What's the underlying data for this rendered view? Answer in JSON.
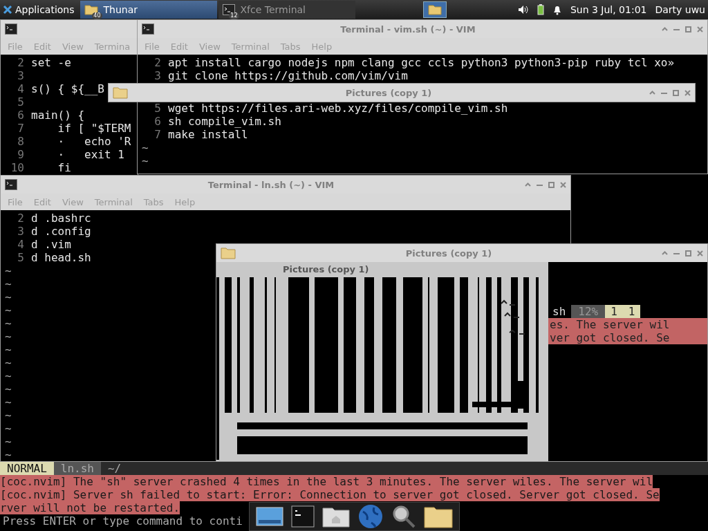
{
  "panel": {
    "apps_menu": "Applications",
    "tasks": [
      {
        "label": "Thunar",
        "badge": "40",
        "selected": true,
        "kind": "folder"
      },
      {
        "label": "Xfce Terminal",
        "badge": "12",
        "selected": false,
        "kind": "terminal"
      }
    ],
    "clock": "Sun  3 Jul, 01:01",
    "user": "Darty uwu"
  },
  "windows": [
    {
      "kind": "terminal",
      "menu": [
        "File",
        "Edit",
        "View",
        "Termina"
      ],
      "lines": [
        {
          "num": "2",
          "text": "set -e"
        },
        {
          "num": "3"
        },
        {
          "num": "4",
          "text": "s() { ${__B"
        },
        {
          "num": "5"
        },
        {
          "num": "6",
          "text": "main() {"
        },
        {
          "num": "7",
          "text": "    if [ \"$TERM"
        },
        {
          "num": "8",
          "text": "    ·   echo 'R"
        },
        {
          "num": "9",
          "text": "    ·   exit 1"
        },
        {
          "num": "10",
          "text": "    fi"
        }
      ]
    },
    {
      "kind": "terminal",
      "title": "Terminal - vim.sh (~) - VIM",
      "menu": [
        "File",
        "Edit",
        "View",
        "Terminal",
        "Tabs",
        "Help"
      ],
      "lines": [
        {
          "num": "2",
          "text": "apt install cargo nodejs npm clang gcc ccls python3 python3-pip ruby tcl xo»"
        },
        {
          "num": "3",
          "text": "git clone https://github.com/vim/vim"
        },
        {
          "num": "5",
          "text": "wget https://files.ari-web.xyz/files/compile_vim.sh"
        },
        {
          "num": "6",
          "text": "sh compile_vim.sh"
        },
        {
          "num": "7",
          "text": "make install"
        },
        {
          "text": "~"
        },
        {
          "text": "~"
        }
      ]
    },
    {
      "kind": "file-manager",
      "title": "Pictures (copy 1)"
    },
    {
      "kind": "terminal",
      "title": "Terminal - ln.sh (~) - VIM",
      "menu": [
        "File",
        "Edit",
        "View",
        "Terminal",
        "Tabs",
        "Help"
      ],
      "lines": [
        {
          "num": "2",
          "text": "d .bashrc"
        },
        {
          "num": "3",
          "text": "d .config"
        },
        {
          "num": "4",
          "text": "d .vim"
        },
        {
          "num": "5",
          "text": "d head.sh"
        },
        {
          "text": "~"
        },
        {
          "text": "~"
        },
        {
          "text": "~"
        },
        {
          "text": "~"
        },
        {
          "text": "~"
        },
        {
          "text": "~"
        },
        {
          "text": "~"
        },
        {
          "text": "~"
        },
        {
          "text": "~"
        },
        {
          "text": "~"
        },
        {
          "text": "~"
        },
        {
          "text": "~"
        },
        {
          "text": "~"
        },
        {
          "text": "~"
        },
        {
          "text": "~"
        }
      ]
    },
    {
      "kind": "file-manager",
      "title": "Pictures (copy 1)",
      "inner_title": "Pictures (copy 1)",
      "fragment": {
        "file": "sh",
        "percent": "12%",
        "line": "1",
        "column": "1",
        "messages": [
          "es. The server wil",
          "ver got closed. Se"
        ]
      }
    }
  ],
  "vim_status": {
    "mode": "NORMAL",
    "file": "ln.sh",
    "path": "~/"
  },
  "messages": [
    "[coc.nvim] The \"sh\" server crashed 4 times in the last 3 minutes. The server wiles. The server wil",
    "[coc.nvim] Server sh failed to start: Error: Connection to server got closed. Server got closed. Se",
    "rver will not be restarted."
  ],
  "prompt": "Press ENTER or type command to conti"
}
